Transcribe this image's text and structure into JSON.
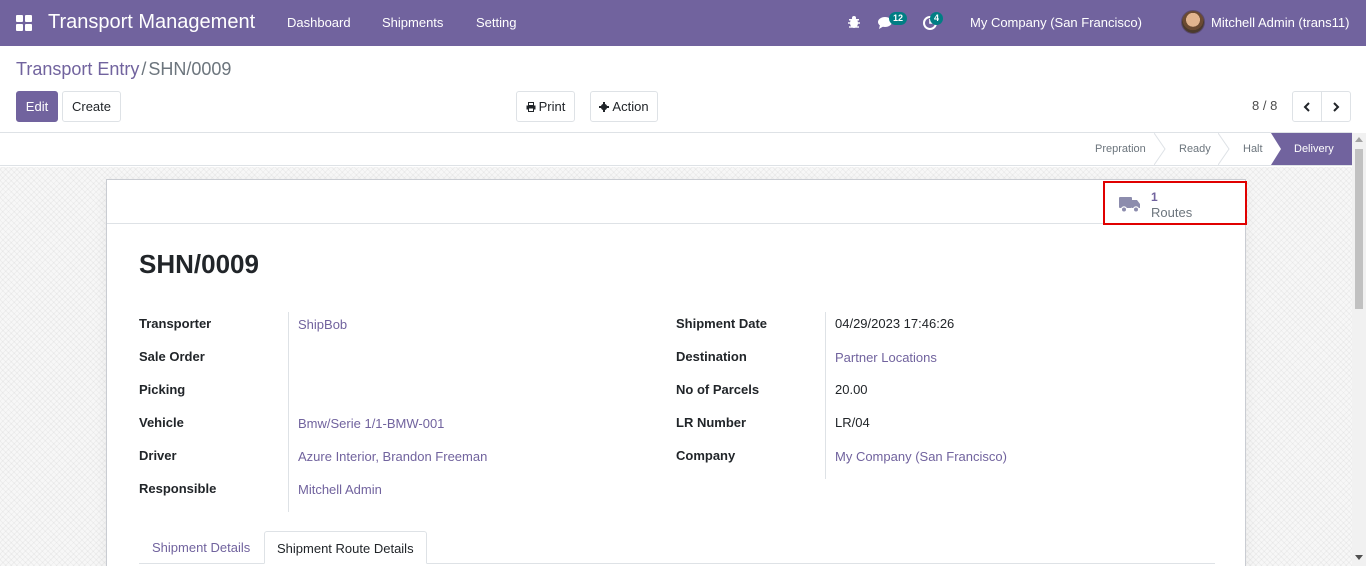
{
  "navbar": {
    "app_title": "Transport Management",
    "menu": [
      "Dashboard",
      "Shipments",
      "Setting"
    ],
    "messages_count": "12",
    "activities_count": "4",
    "company": "My Company (San Francisco)",
    "user": "Mitchell Admin (trans11)",
    "accent_color": "#71639e",
    "badge_color": "#017e84"
  },
  "breadcrumb": {
    "parent": "Transport Entry",
    "separator": "/",
    "current": "SHN/0009"
  },
  "toolbar": {
    "edit_label": "Edit",
    "create_label": "Create",
    "print_label": "Print",
    "action_label": "Action"
  },
  "pager": {
    "value": "8 / 8"
  },
  "statusbar": {
    "stages": [
      "Prepration",
      "Ready",
      "Halt",
      "Delivery"
    ],
    "active_stage": "Delivery"
  },
  "smart_button": {
    "value": "1",
    "label": "Routes",
    "icon": "truck-icon"
  },
  "record": {
    "title": "SHN/0009",
    "left_fields": [
      {
        "label": "Transporter",
        "value": "ShipBob"
      },
      {
        "label": "Sale Order",
        "value": ""
      },
      {
        "label": "Picking",
        "value": ""
      },
      {
        "label": "Vehicle",
        "value": "Bmw/Serie 1/1-BMW-001"
      },
      {
        "label": "Driver",
        "value": "Azure Interior, Brandon Freeman"
      },
      {
        "label": "Responsible",
        "value": "Mitchell Admin"
      }
    ],
    "right_fields": [
      {
        "label": "Shipment Date",
        "value": "04/29/2023 17:46:26"
      },
      {
        "label": "Destination",
        "value": "Partner Locations"
      },
      {
        "label": "No of Parcels",
        "value": "20.00"
      },
      {
        "label": "LR Number",
        "value": "LR/04"
      },
      {
        "label": "Company",
        "value": "My Company (San Francisco)"
      }
    ]
  },
  "tabs": [
    "Shipment Details",
    "Shipment Route Details"
  ],
  "active_tab": "Shipment Route Details"
}
